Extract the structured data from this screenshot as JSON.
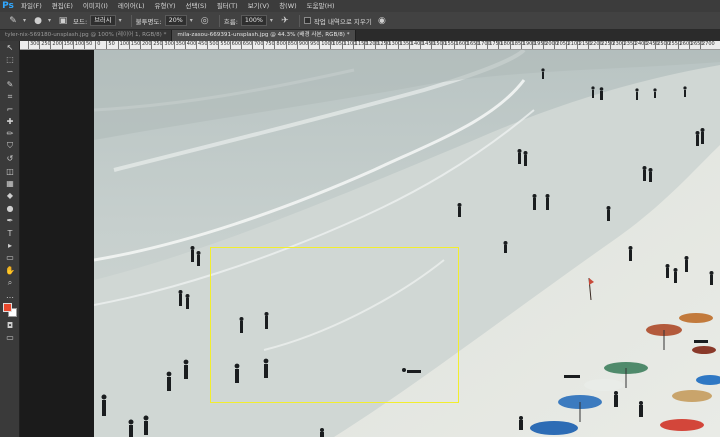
{
  "app": {
    "logo": "Ps"
  },
  "menubar": {
    "items": [
      "파일(F)",
      "편집(E)",
      "이미지(I)",
      "레이어(L)",
      "유형(Y)",
      "선택(S)",
      "필터(T)",
      "보기(V)",
      "창(W)",
      "도움말(H)"
    ]
  },
  "options": {
    "mode_label": "모드:",
    "mode_value": "브러시",
    "opacity_label": "불투명도:",
    "opacity_value": "20%",
    "flow_label": "흐름:",
    "flow_value": "100%",
    "erase_history_label": "작업 내역으로 지우기"
  },
  "tabs": [
    {
      "label": "tyler-nix-569180-unsplash.jpg @ 100% (레이어 1, RGB/8) *",
      "active": false
    },
    {
      "label": "mila-zasou-669391-unsplash.jpg @ 44.3% (배경 사본, RGB/8) *",
      "active": true
    }
  ],
  "ruler": {
    "ticks": [
      "300",
      "250",
      "200",
      "150",
      "100",
      "50",
      "0",
      "50",
      "100",
      "150",
      "200",
      "250",
      "300",
      "350",
      "400",
      "450",
      "500",
      "550",
      "600",
      "650",
      "700",
      "750",
      "800",
      "850",
      "900",
      "950",
      "1000",
      "1050",
      "1100",
      "1150",
      "1200",
      "1250",
      "1300",
      "1350",
      "1400",
      "1450",
      "1500",
      "1550",
      "1600",
      "1650",
      "1700",
      "1750",
      "1800",
      "1850",
      "1900",
      "1950",
      "2000",
      "2050",
      "2100",
      "2150",
      "2200",
      "2250",
      "2300",
      "2350",
      "2400",
      "2450",
      "2500",
      "2550",
      "2600",
      "2650",
      "2700"
    ]
  },
  "toolbar": {
    "tools": [
      {
        "name": "move-tool-icon",
        "glyph": "↖"
      },
      {
        "name": "marquee-tool-icon",
        "glyph": "⬚"
      },
      {
        "name": "lasso-tool-icon",
        "glyph": "∽"
      },
      {
        "name": "quick-select-tool-icon",
        "glyph": "✎"
      },
      {
        "name": "crop-tool-icon",
        "glyph": "⌗"
      },
      {
        "name": "eyedropper-tool-icon",
        "glyph": "⌐"
      },
      {
        "name": "healing-brush-tool-icon",
        "glyph": "✚"
      },
      {
        "name": "brush-tool-icon",
        "glyph": "✏"
      },
      {
        "name": "clone-stamp-tool-icon",
        "glyph": "⛉"
      },
      {
        "name": "history-brush-tool-icon",
        "glyph": "↺"
      },
      {
        "name": "eraser-tool-icon",
        "glyph": "◫"
      },
      {
        "name": "gradient-tool-icon",
        "glyph": "▦"
      },
      {
        "name": "blur-tool-icon",
        "glyph": "◆"
      },
      {
        "name": "dodge-tool-icon",
        "glyph": "●"
      },
      {
        "name": "pen-tool-icon",
        "glyph": "✒"
      },
      {
        "name": "type-tool-icon",
        "glyph": "T"
      },
      {
        "name": "path-select-tool-icon",
        "glyph": "▸"
      },
      {
        "name": "shape-tool-icon",
        "glyph": "▭"
      },
      {
        "name": "hand-tool-icon",
        "glyph": "✋"
      },
      {
        "name": "zoom-tool-icon",
        "glyph": "⌕"
      }
    ]
  },
  "colors": {
    "foreground": "#e8482d",
    "background": "#ffffff",
    "selection_border": "#f2ee2e"
  }
}
